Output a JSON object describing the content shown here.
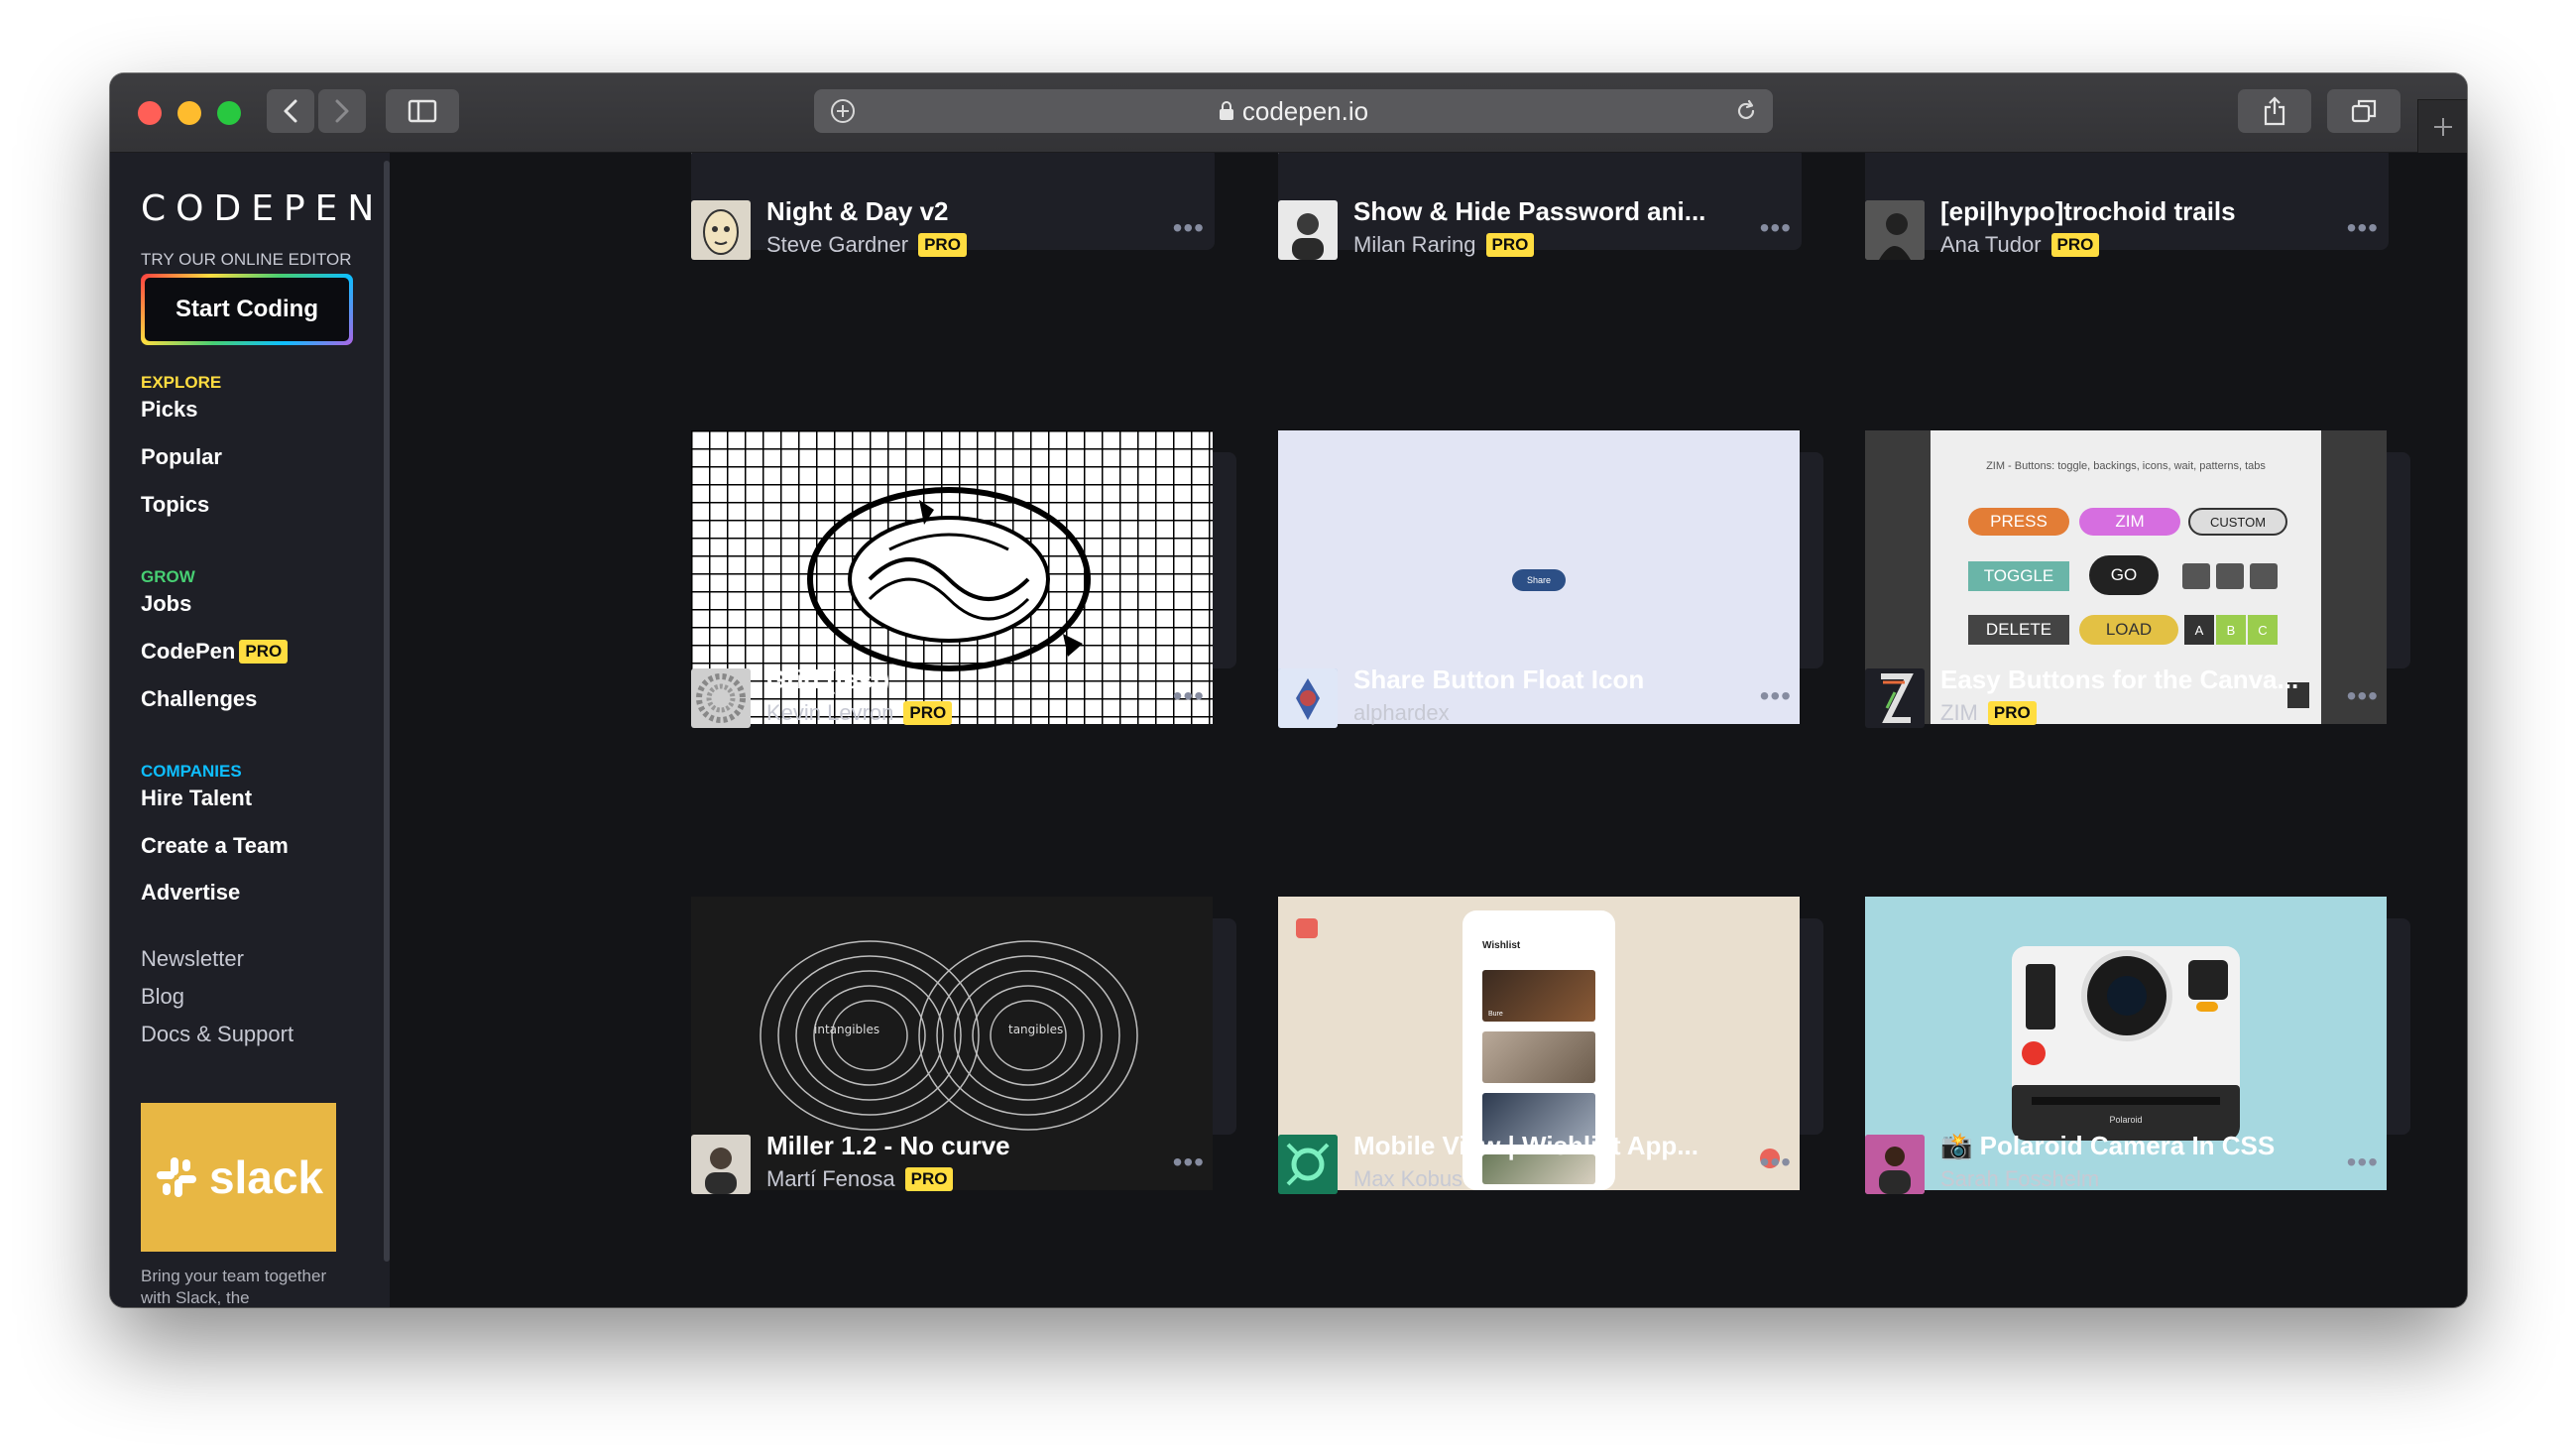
{
  "browser": {
    "url": "codepen.io",
    "colors": {
      "close": "#ff5f57",
      "minimize": "#febc2e",
      "zoom": "#28c840"
    }
  },
  "sidebar": {
    "logo": "CODEPEN",
    "try_label": "TRY OUR ONLINE EDITOR",
    "start_button": "Start Coding",
    "sections": {
      "explore": {
        "label": "EXPLORE",
        "color": "#ffdd40",
        "items": [
          "Picks",
          "Popular",
          "Topics"
        ]
      },
      "grow": {
        "label": "GROW",
        "color": "#47cf73",
        "items": [
          "Jobs",
          "CodePen",
          "Challenges"
        ],
        "pro_badge": "PRO"
      },
      "companies": {
        "label": "COMPANIES",
        "color": "#0ebeff",
        "items": [
          "Hire Talent",
          "Create a Team",
          "Advertise"
        ]
      }
    },
    "links": [
      "Newsletter",
      "Blog",
      "Docs & Support"
    ],
    "ad": {
      "brand": "slack",
      "text": "Bring your team together with Slack, the"
    }
  },
  "pro_label": "PRO",
  "more_label": "•••",
  "cards": [
    {
      "title": "Night & Day v2",
      "author": "Steve Gardner",
      "pro": true
    },
    {
      "title": "Show & Hide Password ani...",
      "author": "Milan Raring",
      "pro": true
    },
    {
      "title": "[epi|hypo]trochoid trails",
      "author": "Ana Tudor",
      "pro": true
    },
    {
      "title": "Grid (test)",
      "author": "Kevin Levron",
      "pro": true
    },
    {
      "title": "Share Button Float Icon",
      "author": "alphardex",
      "pro": false
    },
    {
      "title": "Easy Buttons for the Canva...",
      "author": "ZIM",
      "pro": true
    },
    {
      "title": "Miller 1.2 - No curve",
      "author": "Martí Fenosa",
      "pro": true
    },
    {
      "title": "Mobile View | Wishlist App...",
      "author": "Max Kobus",
      "pro": false
    },
    {
      "title": "📸 Polaroid Camera In CSS",
      "author": "Sarah Fosshelm",
      "pro": false
    }
  ],
  "previews": {
    "share": "Share",
    "zim": {
      "caption": "ZIM - Buttons: toggle, backings, icons, wait, patterns, tabs",
      "buttons": [
        "PRESS",
        "ZIM",
        "CUSTOM",
        "TOGGLE",
        "GO",
        "DELETE",
        "LOAD",
        "A",
        "B",
        "C"
      ]
    },
    "miller": {
      "left": "intangibles",
      "right": "tangibles"
    },
    "wishlist": {
      "heading": "Wishlist",
      "item": "Bure"
    },
    "polaroid": {
      "brand": "Polaroid"
    }
  }
}
